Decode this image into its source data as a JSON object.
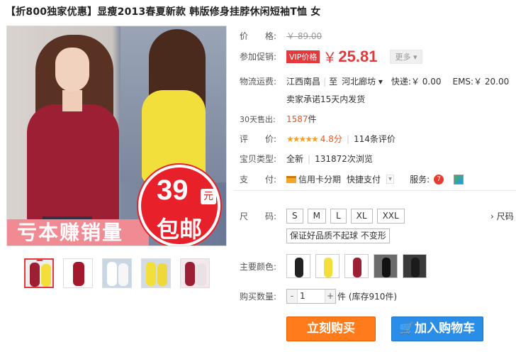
{
  "title": "【折800独家优惠】显瘦2013春夏新款 韩版修身挂脖休闲短袖T恤 女",
  "main_image": {
    "price_badge": "39",
    "price_badge_unit": "元",
    "free_shipping": "包邮",
    "banner": "亏本赚销量"
  },
  "price": {
    "label": "价　　格:",
    "original": "￥ 89.00"
  },
  "promo": {
    "label": "参加促销:",
    "vip_tag": "VIP价格",
    "yen": "￥",
    "price": "25.81",
    "more": "更多 ▾"
  },
  "shipping": {
    "label": "物流运费:",
    "from": "江西南昌",
    "to_prefix": "至",
    "to": "河北廊坊 ▾",
    "express": "快递:￥ 0.00",
    "ems": "EMS:￥ 20.00",
    "promise": "卖家承诺15天内发货"
  },
  "sales": {
    "label": "30天售出:",
    "count": "1587",
    "unit": "件"
  },
  "rating": {
    "label": "评　　价:",
    "stars": "★★★★★",
    "score": "4.8分",
    "reviews": "114条评价"
  },
  "item_type": {
    "label": "宝贝类型:",
    "type": "全新",
    "views": "131872次浏览"
  },
  "payment": {
    "label": "支　　付:",
    "credit": "信用卡分期",
    "quick": "快捷支付",
    "quick_arrow": "▾",
    "service_label": "服务:",
    "service_7": "7"
  },
  "size": {
    "label": "尺　　码:",
    "options": [
      "S",
      "M",
      "L",
      "XL",
      "XXL"
    ],
    "note": "保证好品质不起球 不变形",
    "chart_link": "› 尺码"
  },
  "color": {
    "label": "主要颜色:"
  },
  "quantity": {
    "label": "购买数量:",
    "minus": "-",
    "value": "1",
    "plus": "+",
    "stock": "件 (库存910件)"
  },
  "buttons": {
    "buy": "立刻购买",
    "cart": "加入购物车"
  },
  "colors": {
    "accent_red": "#e4393c",
    "buy_orange": "#ff7b1c",
    "cart_blue": "#2a8de8",
    "star": "#f9a01b"
  }
}
